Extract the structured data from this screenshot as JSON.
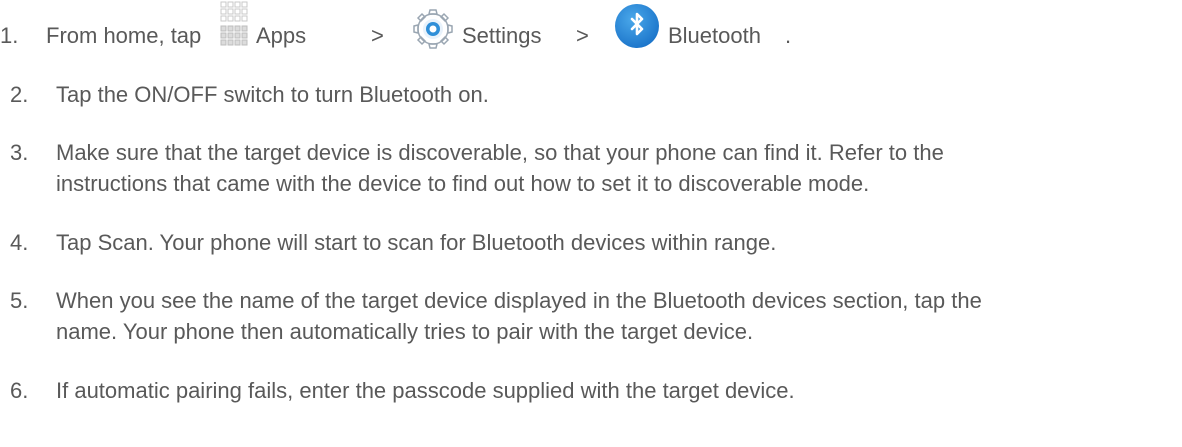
{
  "steps": [
    {
      "number": "1.",
      "part_from_home": "From home, tap",
      "apps_label": "Apps",
      "sep1": ">",
      "settings_label": "Settings",
      "sep2": ">",
      "bluetooth_label": "Bluetooth",
      "end": ".",
      "icons": [
        "apps-grid-icon",
        "settings-gear-icon",
        "bluetooth-icon"
      ]
    },
    {
      "number": "2.",
      "text": "Tap the ON/OFF switch to turn Bluetooth on."
    },
    {
      "number": "3.",
      "line1": "Make sure that the target device is discoverable, so that your phone can find it. Refer to the",
      "line2": "instructions that came with the device to find out how to set it to discoverable mode."
    },
    {
      "number": "4.",
      "text": "Tap Scan. Your phone will start to scan for Bluetooth devices within range."
    },
    {
      "number": "5.",
      "line1": "When you see the name of the target device displayed in the Bluetooth devices section, tap the",
      "line2": "name. Your phone then automatically tries to pair with the target device."
    },
    {
      "number": "6.",
      "text": "If automatic pairing fails, enter the passcode supplied with the target device."
    }
  ],
  "colors": {
    "text": "#595959",
    "bluetooth_blue": "#1a73c9",
    "gear_blue": "#2f8fd8",
    "grid_gray": "#c9c9c9"
  }
}
